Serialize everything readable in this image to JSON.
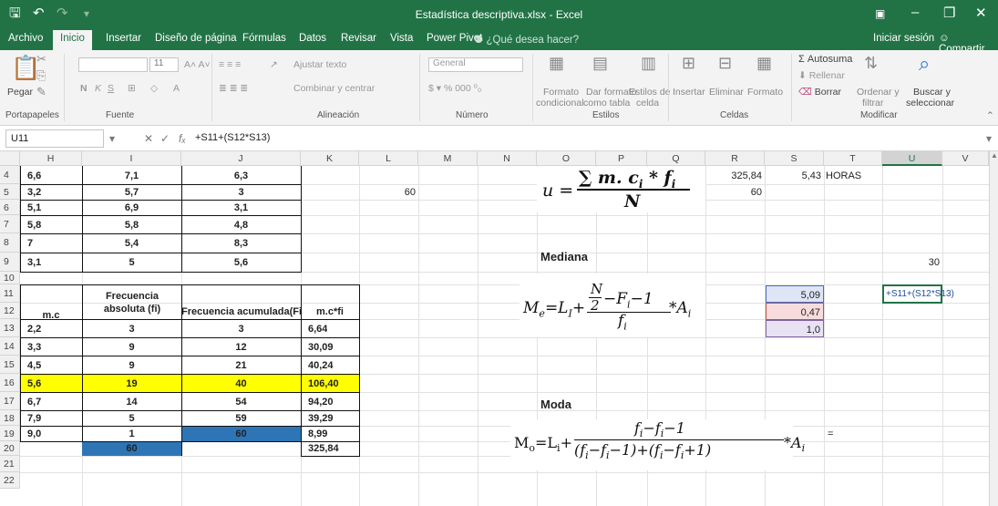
{
  "window": {
    "title": "Estadística descriptiva.xlsx - Excel",
    "share": "Compartir",
    "signin": "Iniciar sesión",
    "tell_me": "¿Qué desea hacer?"
  },
  "tabs": [
    "Archivo",
    "Inicio",
    "Insertar",
    "Diseño de página",
    "Fórmulas",
    "Datos",
    "Revisar",
    "Vista",
    "Power Pivot"
  ],
  "active_tab": "Inicio",
  "ribbon": {
    "paste": "Pegar",
    "font_size": "11",
    "wrap_text": "Ajustar texto",
    "merge_center": "Combinar y centrar",
    "number_format": "General",
    "cond_format": "Formato",
    "cond_format2": "condicional",
    "format_table": "Dar formato",
    "format_table2": "como tabla",
    "cell_styles": "Estilos de",
    "cell_styles2": "celda",
    "insert": "Insertar",
    "delete": "Eliminar",
    "format": "Formato",
    "autosum": "Autosuma",
    "fill": "Rellenar",
    "clear": "Borrar",
    "sort": "Ordenar y",
    "sort2": "filtrar",
    "find": "Buscar y",
    "find2": "seleccionar",
    "groups": [
      "Portapapeles",
      "Fuente",
      "Alineación",
      "Número",
      "Estilos",
      "Celdas",
      "Modificar"
    ]
  },
  "formula_bar": {
    "name_box": "U11",
    "formula": "+S11+(S12*S13)"
  },
  "columns": [
    "H",
    "I",
    "J",
    "K",
    "L",
    "M",
    "N",
    "O",
    "P",
    "Q",
    "R",
    "S",
    "T",
    "U",
    "V"
  ],
  "rows": [
    "4",
    "5",
    "6",
    "7",
    "8",
    "9",
    "10",
    "11",
    "12",
    "13",
    "14",
    "15",
    "16",
    "17",
    "18",
    "19",
    "20",
    "21",
    "22"
  ],
  "top_table": [
    [
      "6,6",
      "7,1",
      "6,3"
    ],
    [
      "3,2",
      "5,7",
      "3"
    ],
    [
      "5,1",
      "6,9",
      "3,1"
    ],
    [
      "5,8",
      "5,8",
      "4,8"
    ],
    [
      "7",
      "5,4",
      "8,3"
    ],
    [
      "3,1",
      "5",
      "5,6"
    ]
  ],
  "freq_table": {
    "headers": [
      "m.c",
      "Frecuencia absoluta (fi)",
      "Frecuencia acumulada(Fi)",
      "m.c*fi"
    ],
    "rows": [
      [
        "2,2",
        "3",
        "3",
        "6,64"
      ],
      [
        "3,3",
        "9",
        "12",
        "30,09"
      ],
      [
        "4,5",
        "9",
        "21",
        "40,24"
      ],
      [
        "5,6",
        "19",
        "40",
        "106,40"
      ],
      [
        "6,7",
        "14",
        "54",
        "94,20"
      ],
      [
        "7,9",
        "5",
        "59",
        "39,29"
      ],
      [
        "9,0",
        "1",
        "60",
        "8,99"
      ]
    ],
    "total_fi": "60",
    "total_mcfi": "325,84"
  },
  "cells": {
    "L5": "60",
    "R4": "325,84",
    "R5": "60",
    "S4": "5,43",
    "T4": "HORAS",
    "U9": "30",
    "S11": "5,09",
    "S12": "0,47",
    "S13": "1,0",
    "U11": "+S11+(S12*S13)",
    "S19": "="
  },
  "labels": {
    "mediana": "Mediana",
    "moda": "Moda"
  },
  "colors": {
    "excel_green": "#217346",
    "highlight": "#ffff00",
    "blue_fill": "#2e75b6"
  }
}
